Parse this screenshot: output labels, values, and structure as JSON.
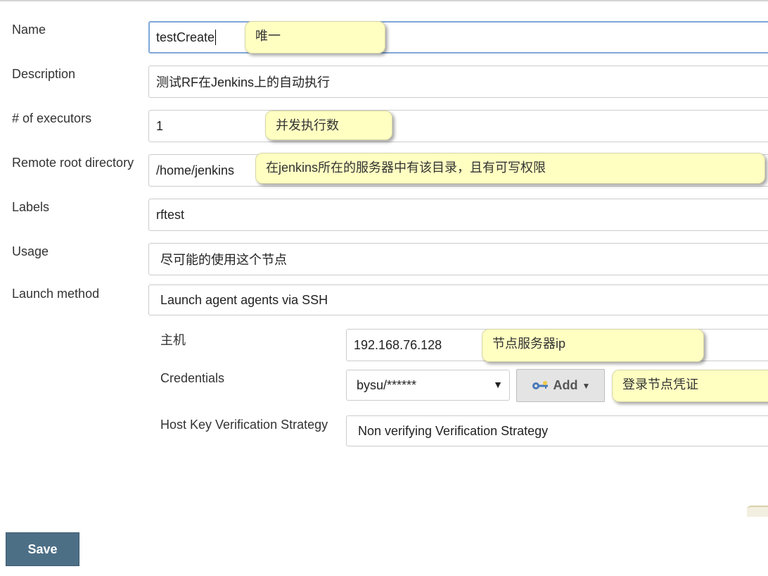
{
  "form": {
    "name": {
      "label": "Name",
      "value": "testCreate",
      "tip": "唯一"
    },
    "description": {
      "label": "Description",
      "value": "测试RF在Jenkins上的自动执行"
    },
    "executors": {
      "label": "# of executors",
      "value": "1",
      "tip": "并发执行数"
    },
    "remote_root": {
      "label": "Remote root directory",
      "value": "/home/jenkins",
      "tip": "在jenkins所在的服务器中有该目录，且有可写权限"
    },
    "labels": {
      "label": "Labels",
      "value": "rftest"
    },
    "usage": {
      "label": "Usage",
      "value": "尽可能的使用这个节点"
    },
    "launch_method": {
      "label": "Launch method",
      "value": "Launch agent agents via SSH"
    }
  },
  "ssh": {
    "host": {
      "label": "主机",
      "value": "192.168.76.128",
      "tip": "节点服务器ip"
    },
    "credentials": {
      "label": "Credentials",
      "selected": "bysu/******",
      "add_label": "Add",
      "tip": "登录节点凭证"
    },
    "host_key": {
      "label": "Host Key Verification Strategy",
      "value": "Non verifying Verification Strategy"
    }
  },
  "actions": {
    "save_label": "Save"
  },
  "icons": {
    "add_icon": "key-icon",
    "select_arrow": "triangle-down-icon"
  },
  "colors": {
    "save_button": "#4d6f86",
    "tooltip_bg": "#ffffc2",
    "focus_border": "#7fa7d9"
  }
}
